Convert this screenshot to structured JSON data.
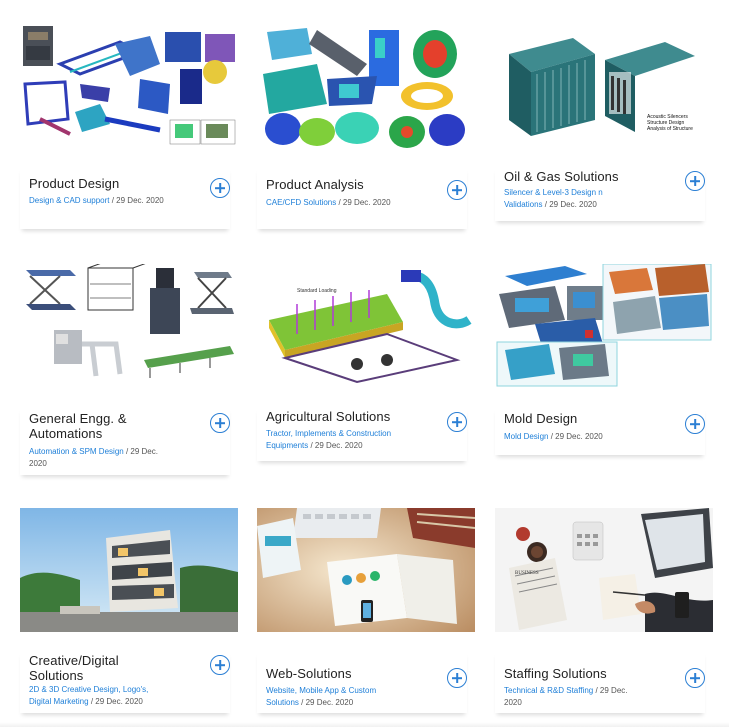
{
  "cards": [
    {
      "title": "Product Design",
      "link": "Design & CAD support",
      "date": "/ 29 Dec. 2020",
      "image": "cad-product-models",
      "action_icon": "plus-circle-icon"
    },
    {
      "title": "Product Analysis",
      "link": "CAE/CFD Solutions",
      "date": "/ 29 Dec. 2020",
      "image": "fea-stress-plots",
      "action_icon": "plus-circle-icon"
    },
    {
      "title": "Oil & Gas Solutions",
      "link": "Silencer & Level-3 Design n Validations",
      "date": "/ 29 Dec. 2020",
      "image": "acoustic-silencer-model",
      "image_caption": "Acoustic Silencers Structure Design Analysis of Structure",
      "action_icon": "plus-circle-icon"
    },
    {
      "title": "General Engg. & Automations",
      "link": "Automation & SPM Design",
      "date": "/ 29 Dec. 2020",
      "image": "lift-table-machinery",
      "action_icon": "plus-circle-icon"
    },
    {
      "title": "Agricultural Solutions",
      "link": "Tractor, Implements & Construction Equipments",
      "date": "/ 29 Dec. 2020",
      "image": "trailer-chassis-analysis",
      "action_icon": "plus-circle-icon"
    },
    {
      "title": "Mold Design",
      "link": "Mold Design",
      "date": "/ 29 Dec. 2020",
      "image": "mold-tool-assemblies",
      "action_icon": "plus-circle-icon"
    },
    {
      "title": "Creative/Digital Solutions",
      "link": "2D & 3D Creative Design, Logo's, Digital Marketing",
      "date": "/ 29 Dec. 2020",
      "image": "building-render-photo",
      "action_icon": "plus-circle-icon"
    },
    {
      "title": "Web-Solutions",
      "link": "Website, Mobile App & Custom Solutions",
      "date": "/ 29 Dec. 2020",
      "image": "web-design-desk-photo",
      "action_icon": "plus-circle-icon"
    },
    {
      "title": "Staffing Solutions",
      "link": "Technical & R&D Staffing",
      "date": "/ 29 Dec. 2020",
      "image": "business-desk-photo",
      "action_icon": "plus-circle-icon"
    }
  ],
  "colors": {
    "link": "#1e7fd8",
    "icon": "#2b7fd4",
    "title": "#222222",
    "meta": "#555555"
  }
}
